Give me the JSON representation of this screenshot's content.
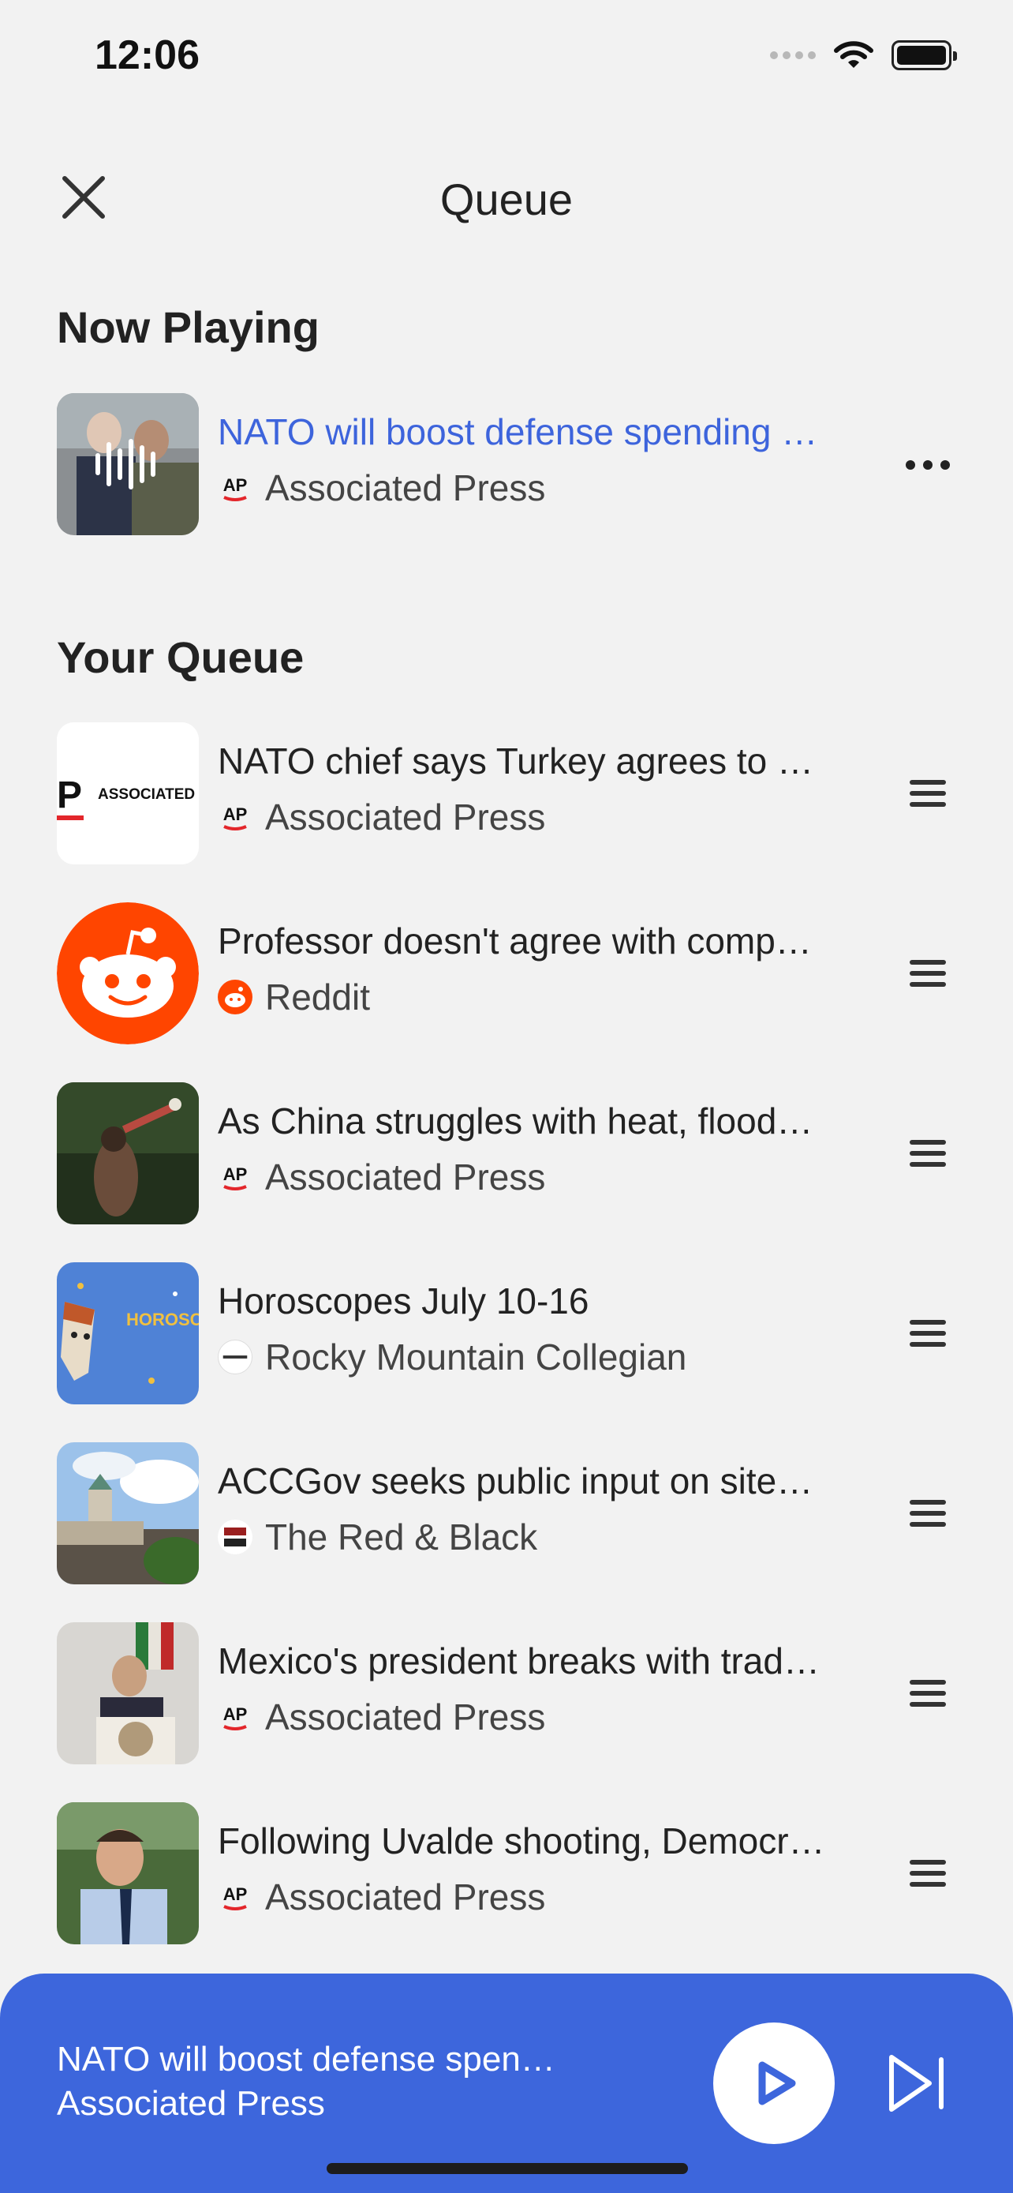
{
  "status_bar": {
    "time": "12:06"
  },
  "header": {
    "title": "Queue"
  },
  "now_playing": {
    "section_title": "Now Playing",
    "item": {
      "title": "NATO will boost defense spending …",
      "source": "Associated Press"
    }
  },
  "queue": {
    "section_title": "Your Queue",
    "items": [
      {
        "title": "NATO chief says Turkey agrees to …",
        "source": "Associated Press",
        "thumb_text": "ASSOCIATED PR"
      },
      {
        "title": "Professor doesn't agree with comp…",
        "source": "Reddit"
      },
      {
        "title": "As China struggles with heat, flood…",
        "source": "Associated Press"
      },
      {
        "title": "Horoscopes July 10-16",
        "source": "Rocky Mountain Collegian",
        "thumb_text": "HOROSCO"
      },
      {
        "title": "ACCGov seeks public input on site…",
        "source": "The Red & Black"
      },
      {
        "title": "Mexico's president breaks with trad…",
        "source": "Associated Press"
      },
      {
        "title": "Following Uvalde shooting, Democr…",
        "source": "Associated Press"
      }
    ]
  },
  "mini_player": {
    "title": "NATO will boost defense spen…",
    "source": "Associated Press"
  },
  "colors": {
    "accent": "#3d66dc",
    "background": "#f2f2f2",
    "reddit": "#ff4500",
    "ap_red": "#e3262b"
  }
}
